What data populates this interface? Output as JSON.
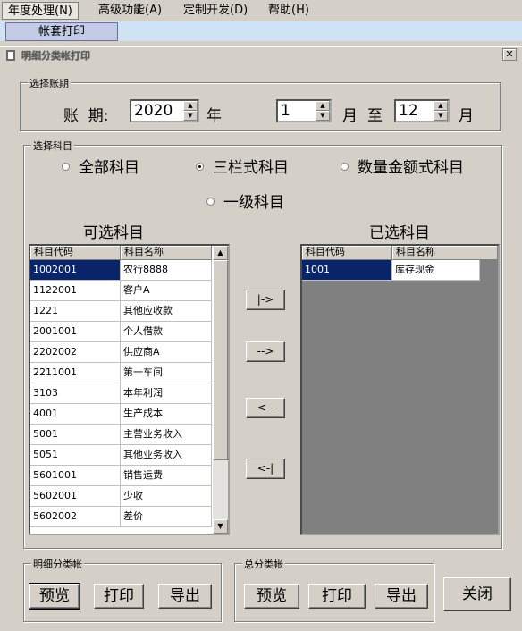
{
  "menubar": {
    "items": [
      "年度处理(N)",
      "高级功能(A)",
      "定制开发(D)",
      "帮助(H)"
    ],
    "submenu_item": "帐套打印"
  },
  "window": {
    "title": "明细分类帐打印",
    "close_glyph": "✕"
  },
  "period": {
    "legend": "选择账期",
    "label": "账  期:",
    "year_value": "2020",
    "year_unit": "年",
    "start_month": "1",
    "month_unit": "月",
    "to": "至",
    "end_month": "12",
    "month_unit2": "月"
  },
  "subjects": {
    "legend": "选择科目",
    "radios": [
      {
        "label": "全部科目",
        "checked": false
      },
      {
        "label": "三栏式科目",
        "checked": true
      },
      {
        "label": "数量金额式科目",
        "checked": false
      },
      {
        "label": "一级科目",
        "checked": false
      }
    ],
    "available_title": "可选科目",
    "selected_title": "已选科目",
    "columns": [
      "科目代码",
      "科目名称"
    ],
    "available_rows": [
      [
        "1002001",
        "农行8888"
      ],
      [
        "1122001",
        "客户A"
      ],
      [
        "1221",
        "其他应收款"
      ],
      [
        "2001001",
        "个人借款"
      ],
      [
        "2202002",
        "供应商A"
      ],
      [
        "2211001",
        "第一车间"
      ],
      [
        "3103",
        "本年利润"
      ],
      [
        "4001",
        "生产成本"
      ],
      [
        "5001",
        "主营业务收入"
      ],
      [
        "5051",
        "其他业务收入"
      ],
      [
        "5601001",
        "销售运费"
      ],
      [
        "5602001",
        "少收"
      ],
      [
        "5602002",
        "差价"
      ]
    ],
    "selected_rows": [
      [
        "1001",
        "库存现金"
      ]
    ],
    "move_buttons": [
      "|->",
      "-->",
      "<--",
      "<-|"
    ]
  },
  "detail_group": {
    "legend": "明细分类帐",
    "preview": "预览",
    "print": "打印",
    "export": "导出"
  },
  "total_group": {
    "legend": "总分类帐",
    "preview": "预览",
    "print": "打印",
    "export": "导出"
  },
  "close_button": "关闭",
  "colors": {
    "selection": "#0a246a",
    "window_bg": "#d4d0c8",
    "empty_list_bg": "#808080"
  }
}
